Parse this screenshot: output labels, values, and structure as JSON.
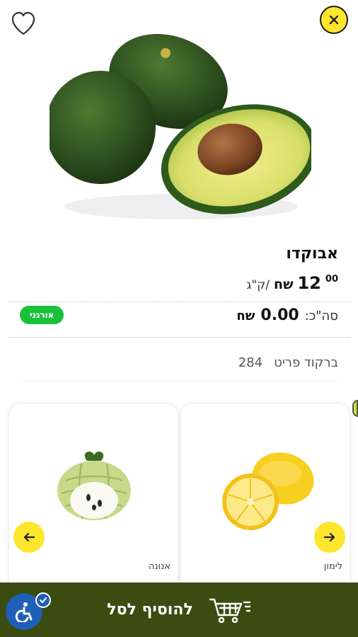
{
  "product": {
    "name": "אבוקדו",
    "price_int": "12",
    "price_dec": "00",
    "currency": "שח",
    "unit": "/ק\"ג",
    "total_label": "סה\"כ:",
    "total_value": "0.00",
    "total_currency": "שח",
    "badge": "אורגני",
    "barcode_label": "ברקוד פריט",
    "barcode_value": "284"
  },
  "related": [
    {
      "label": "לימון"
    },
    {
      "label": "אנונה"
    }
  ],
  "cart": {
    "label": "להוסיף לסל"
  },
  "colors": {
    "accent_yellow": "#ffe62e",
    "organic_green": "#19c13a",
    "cart_bar": "#3a4c10",
    "accessibility_blue": "#1f5fb5"
  },
  "icons": {
    "favorite": "heart-icon",
    "close": "close-icon",
    "next": "arrow-right-icon",
    "prev": "arrow-left-icon",
    "cart": "shopping-cart-icon",
    "accessibility": "accessibility-icon"
  }
}
